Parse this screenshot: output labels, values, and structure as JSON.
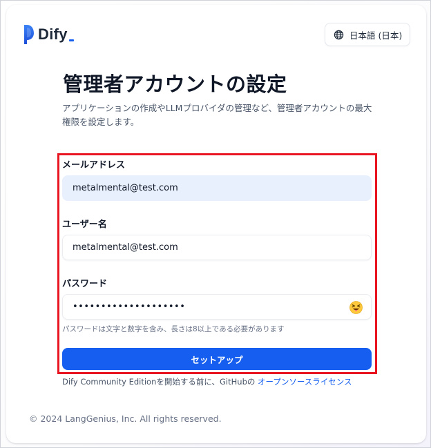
{
  "header": {
    "logo_text": "Dify",
    "language_label": "日本語 (日本)"
  },
  "main": {
    "title": "管理者アカウントの設定",
    "subtitle": "アプリケーションの作成やLLMプロバイダの管理など、管理者アカウントの最大権限を設定します。"
  },
  "form": {
    "email_label": "メールアドレス",
    "email_value": "metalmental@test.com",
    "username_label": "ユーザー名",
    "username_value": "metalmental@test.com",
    "password_label": "パスワード",
    "password_value": "••••••••••••••••••••",
    "password_hint": "パスワードは文字と数字を含み、長さは8以上である必要があります",
    "submit_label": "セットアップ"
  },
  "terms": {
    "prefix": "Dify Community Editionを開始する前に、GitHubの ",
    "link_text": "オープンソースライセンス"
  },
  "footer": {
    "copyright": "© 2024 LangGenius, Inc. All rights reserved."
  },
  "colors": {
    "accent": "#155eef",
    "highlight_box": "#e8141f",
    "autofill": "#e8f0fe"
  },
  "icons": {
    "language": "globe-icon",
    "password_toggle": "squinting-tongue-emoji-icon"
  }
}
